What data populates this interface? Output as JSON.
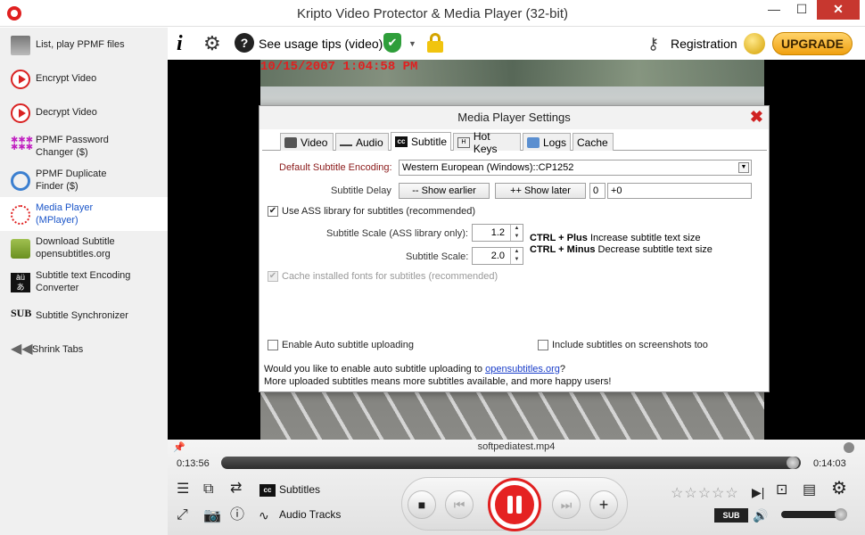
{
  "window": {
    "title": "Kripto Video Protector & Media Player (32-bit)",
    "min": "—",
    "max": "☐",
    "close": "✕"
  },
  "sidebar": {
    "items": [
      {
        "label": "List, play PPMF files",
        "icon": "film-icon"
      },
      {
        "label": "Encrypt Video",
        "icon": "play-lock-icon"
      },
      {
        "label": "Decrypt Video",
        "icon": "play-unlock-icon"
      },
      {
        "label": "PPMF Password Changer ($)",
        "icon": "password-icon"
      },
      {
        "label": "PPMF Duplicate Finder ($)",
        "icon": "search-icon"
      },
      {
        "label": "Media Player (MPlayer)",
        "icon": "media-player-icon"
      },
      {
        "label": "Download Subtitle opensubtitles.org",
        "icon": "download-icon"
      },
      {
        "label": "Subtitle text Encoding Converter",
        "icon": "encoding-icon"
      },
      {
        "label": "Subtitle Synchronizer",
        "icon": "sub-icon"
      },
      {
        "label": "Shrink Tabs",
        "icon": "shrink-icon"
      }
    ],
    "active_index": 5
  },
  "toolbar": {
    "info": "i",
    "help": "?",
    "tips_label": "See usage tips (video)",
    "registration_label": "Registration",
    "upgrade_label": "UPGRADE"
  },
  "video": {
    "timestamp": "10/15/2007 1:04:58 PM"
  },
  "dialog": {
    "title": "Media Player Settings",
    "tabs": [
      {
        "label": "Video"
      },
      {
        "label": "Audio"
      },
      {
        "label": "Subtitle"
      },
      {
        "label": "Hot Keys"
      },
      {
        "label": "Logs"
      },
      {
        "label": "Cache"
      }
    ],
    "active_tab": "Subtitle",
    "encoding_label": "Default Subtitle Encoding:",
    "encoding_value": "Western European (Windows)::CP1252",
    "delay_label": "Subtitle Delay",
    "show_earlier": "-- Show earlier",
    "show_later": "++ Show later",
    "delay_value": "0",
    "delay_text": "+0",
    "use_ass_label": "Use ASS library for subtitles (recommended)",
    "use_ass_checked": true,
    "scale_ass_label": "Subtitle Scale (ASS library only):",
    "scale_ass_value": "1.2",
    "scale_label": "Subtitle Scale:",
    "scale_value": "2.0",
    "hint_plus_key": "CTRL + Plus",
    "hint_plus_text": " Increase subtitle text size",
    "hint_minus_key": "CTRL + Minus",
    "hint_minus_text": " Decrease subtitle text size",
    "cache_fonts_label": "Cache installed fonts for subtitles (recommended)",
    "auto_upload_label": "Enable Auto subtitle uploading",
    "include_screenshots_label": "Include subtitles on screenshots too",
    "note_line1_pre": "Would you like to enable auto subtitle uploading to ",
    "note_link": "opensubtitles.org",
    "note_line1_post": "?",
    "note_line2": "More uploaded subtitles means more subtitles available, and more happy users!"
  },
  "player": {
    "filename": "softpediatest.mp4",
    "elapsed": "0:13:56",
    "total": "0:14:03",
    "progress": 0.99,
    "volume": 1.0,
    "subtitles_label": "Subtitles",
    "audio_tracks_label": "Audio Tracks",
    "rating": 0,
    "rating_max": 5,
    "subsound": "SUB",
    "cc": "cc"
  }
}
